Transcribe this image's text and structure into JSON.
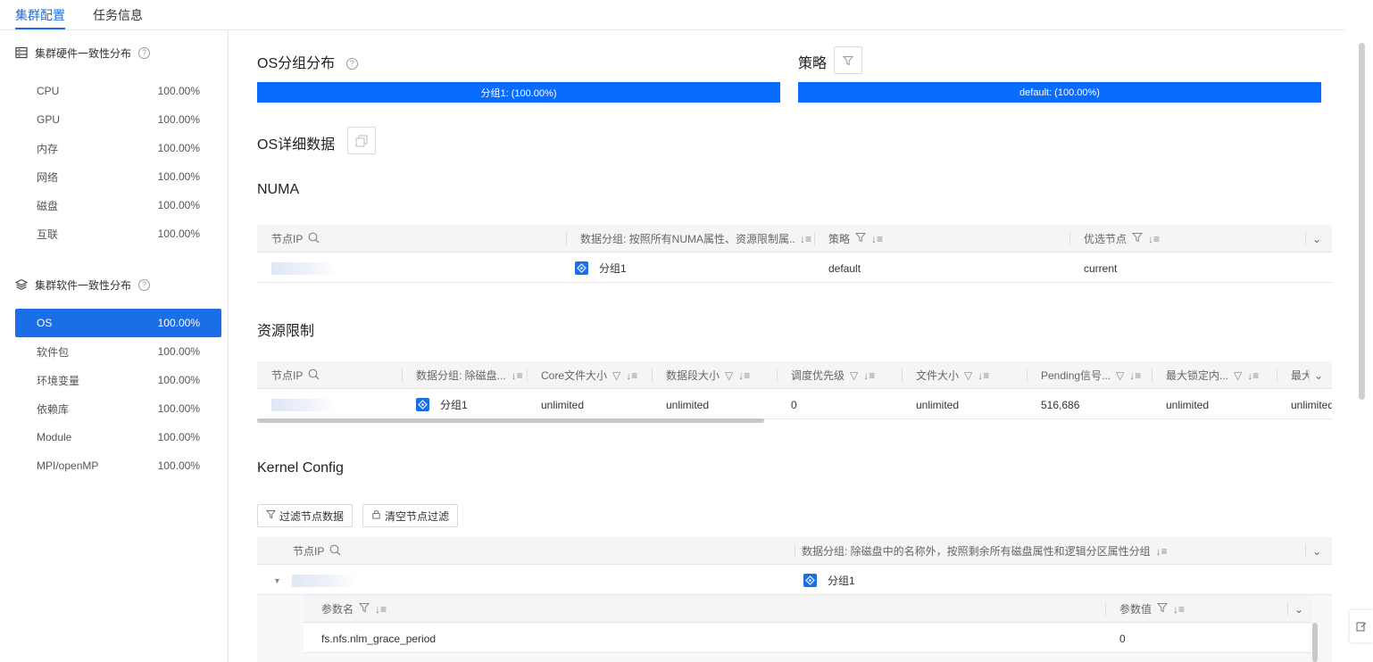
{
  "tabs": [
    {
      "label": "集群配置",
      "active": true
    },
    {
      "label": "任务信息",
      "active": false
    }
  ],
  "sidebar": {
    "hardware_title": "集群硬件一致性分布",
    "hardware_items": [
      {
        "label": "CPU",
        "value": "100.00%"
      },
      {
        "label": "GPU",
        "value": "100.00%"
      },
      {
        "label": "内存",
        "value": "100.00%"
      },
      {
        "label": "网络",
        "value": "100.00%"
      },
      {
        "label": "磁盘",
        "value": "100.00%"
      },
      {
        "label": "互联",
        "value": "100.00%"
      }
    ],
    "software_title": "集群软件一致性分布",
    "software_items": [
      {
        "label": "OS",
        "value": "100.00%",
        "active": true
      },
      {
        "label": "软件包",
        "value": "100.00%"
      },
      {
        "label": "环境变量",
        "value": "100.00%"
      },
      {
        "label": "依赖库",
        "value": "100.00%"
      },
      {
        "label": "Module",
        "value": "100.00%"
      },
      {
        "label": "MPI/openMP",
        "value": "100.00%"
      }
    ]
  },
  "main": {
    "os_group_title": "OS分组分布",
    "os_group_bar": "分组1: (100.00%)",
    "policy_title": "策略",
    "policy_bar": "default: (100.00%)",
    "os_detail_title": "OS详细数据",
    "numa": {
      "title": "NUMA",
      "headers": [
        "节点IP",
        "数据分组: 按照所有NUMA属性、资源限制属...",
        "策略",
        "优选节点"
      ],
      "row": {
        "group": "分组1",
        "policy": "default",
        "preferred": "current"
      }
    },
    "resource": {
      "title": "资源限制",
      "headers": [
        "节点IP",
        "数据分组: 除磁盘...",
        "Core文件大小",
        "数据段大小",
        "调度优先级",
        "文件大小",
        "Pending信号...",
        "最大锁定内...",
        "最大"
      ],
      "row": [
        "分组1",
        "unlimited",
        "unlimited",
        "0",
        "unlimited",
        "516,686",
        "unlimited",
        "unlimited"
      ]
    },
    "kernel": {
      "title": "Kernel Config",
      "filter_btn": "过滤节点数据",
      "clear_btn": "清空节点过滤",
      "headers": [
        "节点IP",
        "数据分组: 除磁盘中的名称外，按照剩余所有磁盘属性和逻辑分区属性分组"
      ],
      "row_group": "分组1",
      "sub_headers": [
        "参数名",
        "参数值"
      ],
      "sub_row": {
        "name": "fs.nfs.nlm_grace_period",
        "value": "0"
      }
    }
  },
  "colors": {
    "accent": "#1a6fe8",
    "bar": "#0a6cff"
  }
}
